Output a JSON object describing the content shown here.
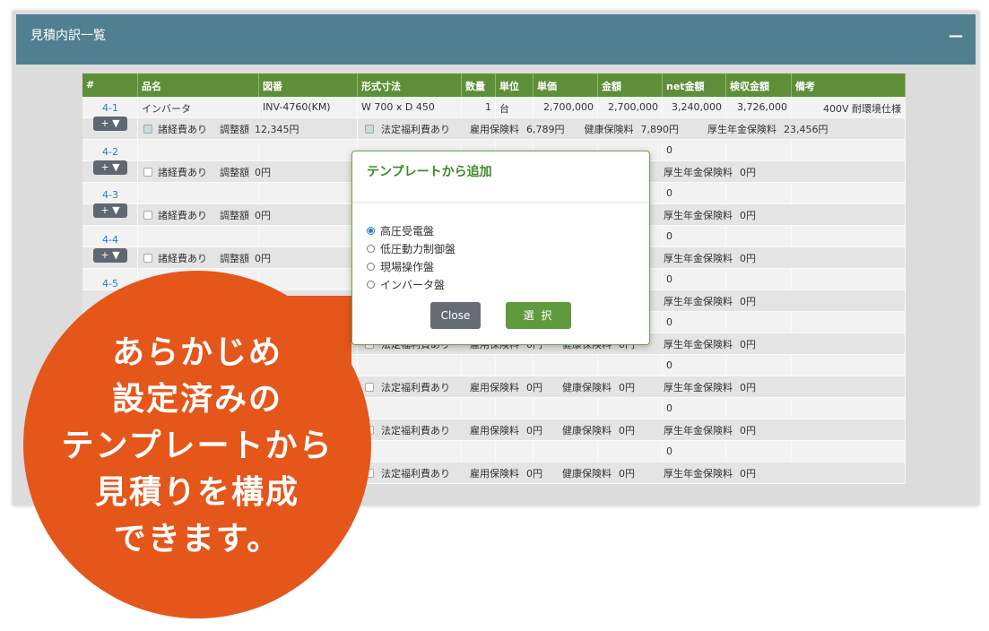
{
  "panel": {
    "title": "見積内訳一覧",
    "collapse_icon": "minus-icon"
  },
  "table": {
    "headers": [
      "#",
      "品名",
      "図番",
      "形式寸法",
      "数量",
      "単位",
      "単価",
      "金額",
      "net金額",
      "検収金額",
      "備考"
    ],
    "add_button": "+ ▼",
    "first_row": {
      "no": "4-1",
      "name": "インバータ",
      "drawing": "INV-4760(KM)",
      "dims": "W 700 x D 450",
      "qty": "1",
      "unit": "台",
      "unit_price": "2,700,000",
      "amount": "2,700,000",
      "net": "3,240,000",
      "acceptance": "3,726,000",
      "note": "400V 耐環境仕様"
    },
    "first_sub": {
      "expenses": "諸経費あり",
      "adjust_label": "調整額",
      "adjust_value": "12,345円",
      "welfare": "法定福利費あり",
      "employment": "雇用保険料",
      "employment_value": "6,789円",
      "health": "健康保険料",
      "health_value": "7,890円",
      "pension": "厚生年金保険料",
      "pension_value": "23,456円"
    },
    "row_numbers": [
      "4-2",
      "4-3",
      "4-4",
      "4-5"
    ],
    "empty_sub": {
      "expenses": "諸経費あり",
      "adjust_label": "調整額",
      "zero": "0円",
      "welfare": "法定福利費あり",
      "employment": "雇用保険料",
      "health": "健康保険料",
      "pension": "厚生年金保険料",
      "zero_plain": "0"
    }
  },
  "modal": {
    "title": "テンプレートから追加",
    "options": [
      "高圧受電盤",
      "低圧動力制御盤",
      "現場操作盤",
      "インバータ盤"
    ],
    "selected_index": 0,
    "close_label": "Close",
    "select_label": "選 択"
  },
  "callout": {
    "lines": [
      "あらかじめ",
      "設定済みの",
      "テンプレートから",
      "見積りを構成",
      "できます。"
    ],
    "color": "#e5561b"
  },
  "colors": {
    "header": "#507f90",
    "table_head": "#5e8f38",
    "link": "#2a78c8"
  }
}
